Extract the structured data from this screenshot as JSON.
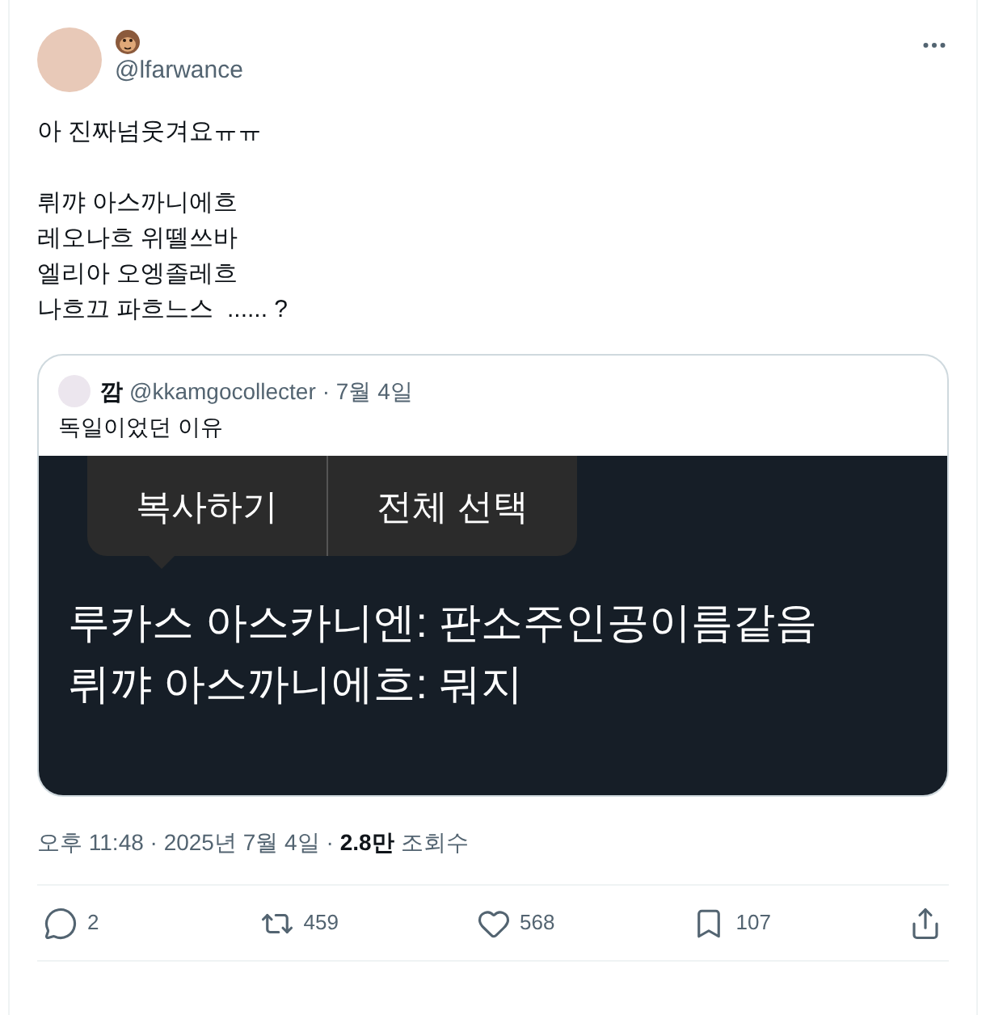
{
  "author": {
    "handle": "@lfarwance"
  },
  "body": [
    [
      "아 진짜넘웃겨요ㅠㅠ"
    ],
    [
      "뤼꺄 아스까니에흐",
      "레오나흐 위뗄쓰바",
      "엘리아 오엥졸레흐",
      "나흐끄 파흐느스  ...... ?"
    ]
  ],
  "quote": {
    "name": "깜",
    "handle": "@kkamgocollecter",
    "date": "· 7월 4일",
    "text": "독일이었던 이유",
    "screenshot": {
      "menu": [
        {
          "label": "복사하기"
        },
        {
          "label": "전체 선택"
        }
      ],
      "lines": [
        "루카스 아스카니엔: 판소주인공이름같음",
        "뤼꺄 아스까니에흐: 뭐지"
      ]
    }
  },
  "meta": {
    "time": "오후 11:48 · 2025년 7월 4일 ·",
    "views": "2.8만",
    "views_label": "조회수"
  },
  "actions": [
    {
      "kind": "reply",
      "count": "2"
    },
    {
      "kind": "repost",
      "count": "459"
    },
    {
      "kind": "like",
      "count": "568"
    },
    {
      "kind": "bookmark",
      "count": "107"
    },
    {
      "kind": "share"
    }
  ]
}
